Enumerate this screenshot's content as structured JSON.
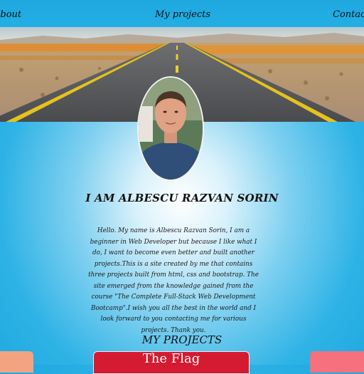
{
  "nav": {
    "about": "About",
    "projects": "My projects",
    "contact": "Contact"
  },
  "hero": {
    "alt": "desert road"
  },
  "profile": {
    "name_title": "I AM ALBESCU RAZVAN SORIN",
    "bio": "Hello. My name is Albescu Razvan Sorin, I am a beginner in Web Developer but because I like what I do, I want to become even better and built another projects.This is a site created by me that contains three projects built from html, css and bootstrap. The site emerged from the knowledge gained from the course \"The Complete Full-Stack Web Development Bootcamp\".I wish you all the best in the world and I look forward to you contacting me for various projects. Thank you."
  },
  "projects": {
    "heading": "MY PROJECTS",
    "cards": [
      {
        "label": ""
      },
      {
        "label": "The Flag"
      },
      {
        "label": ""
      }
    ]
  },
  "colors": {
    "nav_bg": "#1fa8e0",
    "card_left": "#f4a382",
    "card_mid": "#d41b31",
    "card_right": "#f4717d"
  }
}
